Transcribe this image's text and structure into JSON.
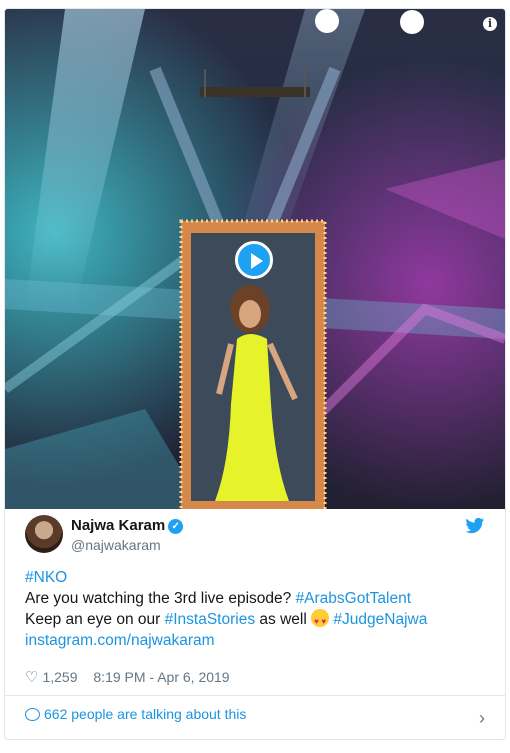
{
  "tweet": {
    "author_name": "Najwa Karam",
    "author_handle": "@najwakaram",
    "line1_tag": "#NKO",
    "line2_text": "Are you watching the 3rd live episode?",
    "line2_tag": "#ArabsGotTalent",
    "line3_text_a": "Keep an eye on our",
    "line3_tag_a": "#InstaStories",
    "line3_text_b": "as well",
    "line3_tag_b": "#JudgeNajwa",
    "link": "instagram.com/najwakaram",
    "likes": "1,259",
    "timestamp": "8:19 PM - Apr 6, 2019",
    "talking": "662 people are talking about this"
  },
  "icons": {
    "info": "info-icon",
    "play": "play-icon",
    "verified": "verified-icon",
    "bird": "twitter-bird-icon",
    "heart": "heart-icon",
    "bubble": "speech-bubble-icon",
    "chevron": "chevron-right-icon",
    "emoji": "heart-eyes-emoji"
  },
  "colors": {
    "link": "#1b95e0",
    "brand": "#1da1f2",
    "muted": "#657786"
  }
}
